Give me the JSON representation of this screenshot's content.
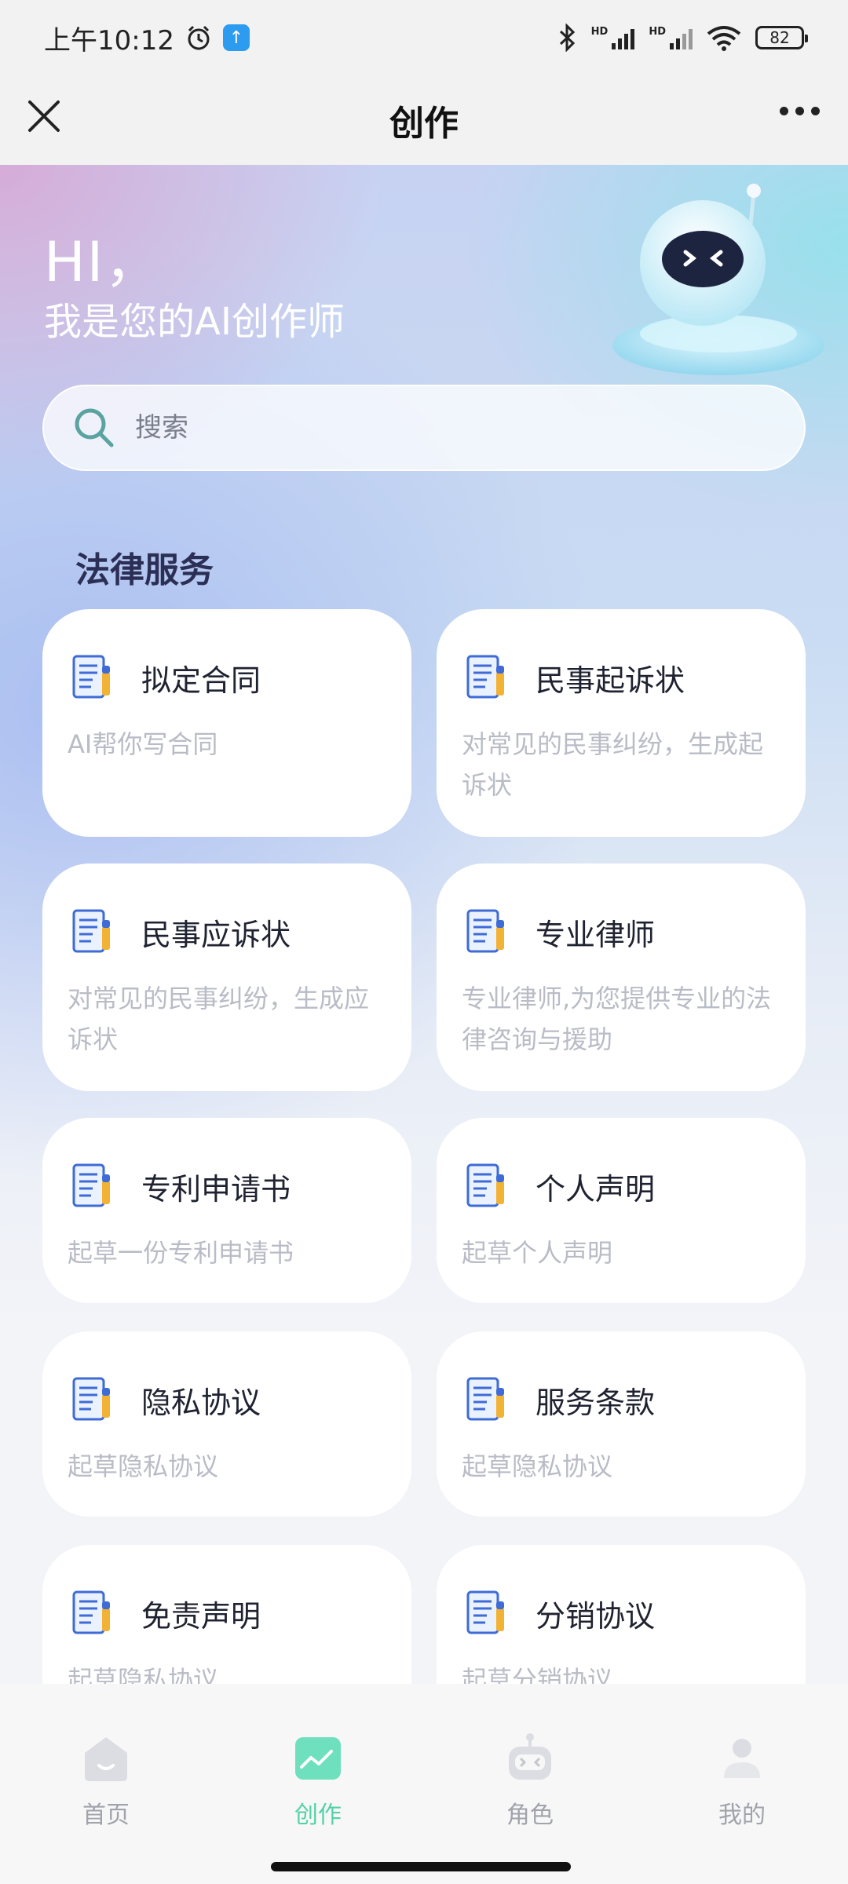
{
  "status_bar": {
    "time": "上午10:12",
    "battery": "82",
    "hd_label": "HD"
  },
  "nav": {
    "title": "创作"
  },
  "hero": {
    "greeting": "HI，",
    "subtitle": "我是您的AI创作师"
  },
  "search": {
    "placeholder": "搜索"
  },
  "section": {
    "title": "法律服务"
  },
  "cards": [
    {
      "title": "拟定合同",
      "desc": "AI帮你写合同"
    },
    {
      "title": "民事起诉状",
      "desc": "对常见的民事纠纷，生成起诉状"
    },
    {
      "title": "民事应诉状",
      "desc": "对常见的民事纠纷，生成应诉状"
    },
    {
      "title": "专业律师",
      "desc": "专业律师,为您提供专业的法律咨询与援助"
    },
    {
      "title": "专利申请书",
      "desc": "起草一份专利申请书"
    },
    {
      "title": "个人声明",
      "desc": "起草个人声明"
    },
    {
      "title": "隐私协议",
      "desc": "起草隐私协议"
    },
    {
      "title": "服务条款",
      "desc": "起草隐私协议"
    },
    {
      "title": "免责声明",
      "desc": "起草隐私协议"
    },
    {
      "title": "分销协议",
      "desc": "起草分销协议"
    }
  ],
  "tabs": [
    {
      "label": "首页",
      "icon": "home-icon",
      "active": false
    },
    {
      "label": "创作",
      "icon": "create-icon",
      "active": true
    },
    {
      "label": "角色",
      "icon": "robot-icon",
      "active": false
    },
    {
      "label": "我的",
      "icon": "profile-icon",
      "active": false
    }
  ],
  "colors": {
    "accent": "#54d1a8",
    "section_title": "#2c2f55",
    "desc_text": "#b9bcc6"
  }
}
